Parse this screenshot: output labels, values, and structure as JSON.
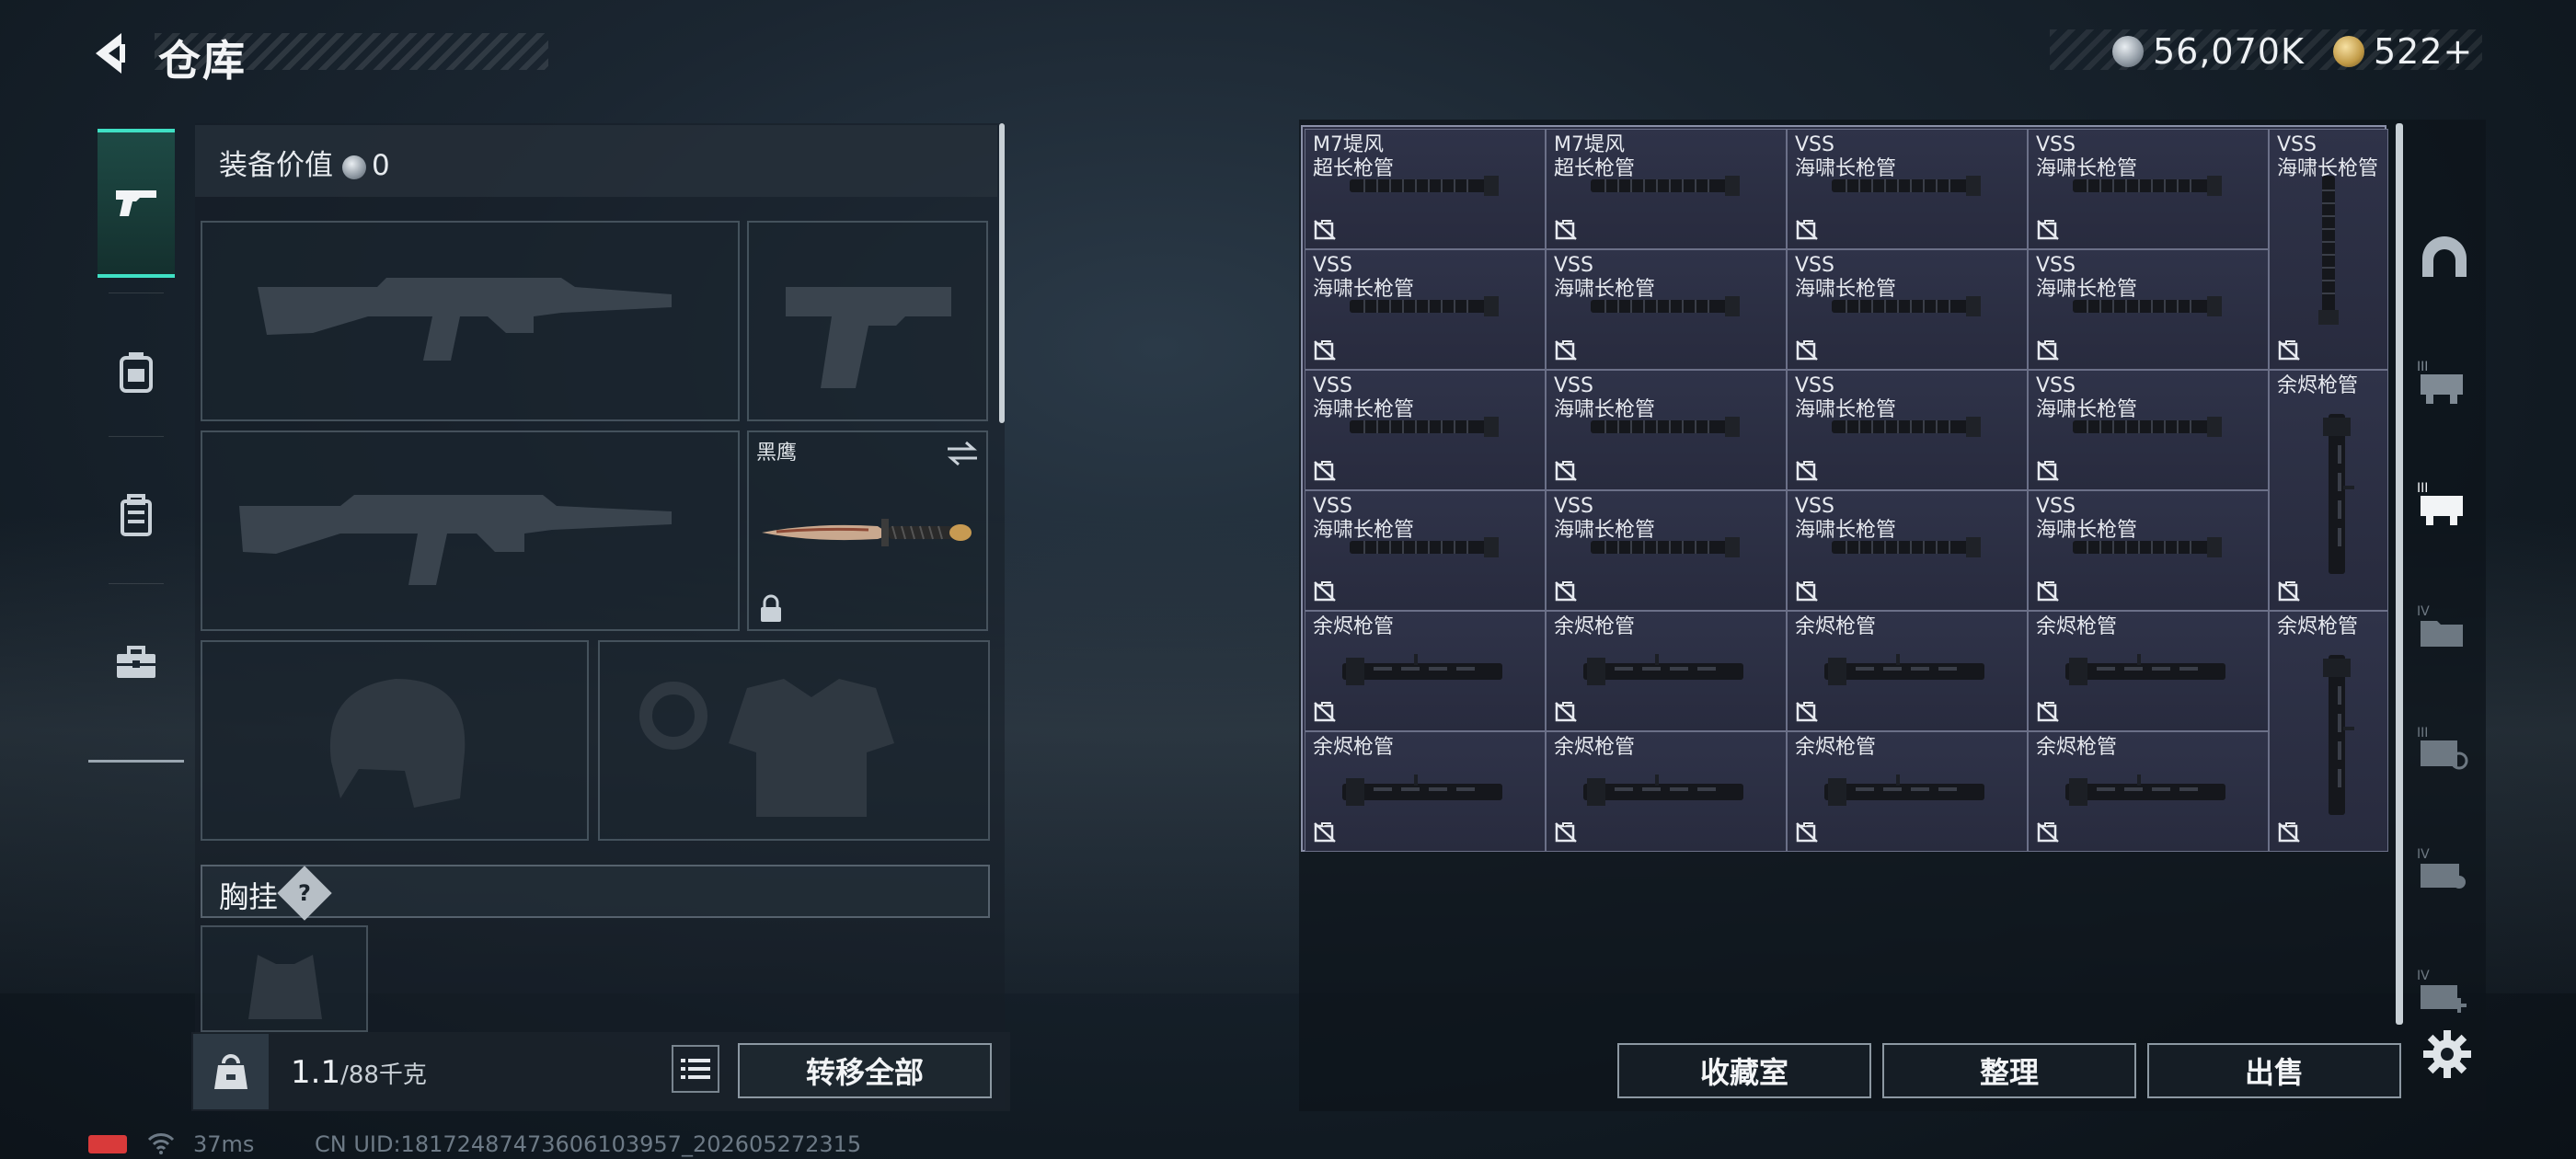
{
  "header": {
    "title": "仓库",
    "currencies": [
      {
        "icon": "silver-coin-icon",
        "value": "56,070K"
      },
      {
        "icon": "gold-coin-icon",
        "value": "522+"
      }
    ]
  },
  "left_rail": {
    "tabs": [
      {
        "icon": "pistol-icon",
        "active": true
      },
      {
        "icon": "backpack-armor-icon",
        "active": false
      },
      {
        "icon": "backpack-icon",
        "active": false
      },
      {
        "icon": "toolbox-icon",
        "active": false
      }
    ]
  },
  "equipment": {
    "value_label": "装备价值",
    "value": "0",
    "melee_label": "黑鹰",
    "chest_label": "胸挂",
    "help": "?"
  },
  "bottom_left": {
    "weight_current": "1.1",
    "weight_capacity": "/88千克",
    "transfer_all": "转移全部"
  },
  "storage": {
    "rows": [
      [
        "M7堤风\n超长枪管",
        "M7堤风\n超长枪管",
        "VSS\n海啸长枪管",
        "VSS\n海啸长枪管"
      ],
      [
        "VSS\n海啸长枪管",
        "VSS\n海啸长枪管",
        "VSS\n海啸长枪管",
        "VSS\n海啸长枪管"
      ],
      [
        "VSS\n海啸长枪管",
        "VSS\n海啸长枪管",
        "VSS\n海啸长枪管",
        "VSS\n海啸长枪管"
      ],
      [
        "VSS\n海啸长枪管",
        "VSS\n海啸长枪管",
        "VSS\n海啸长枪管",
        "VSS\n海啸长枪管"
      ],
      [
        "余烬枪管",
        "余烬枪管",
        "余烬枪管",
        "余烬枪管"
      ],
      [
        "余烬枪管",
        "余烬枪管",
        "余烬枪管",
        "余烬枪管"
      ]
    ],
    "tall_column": [
      "VSS\n海啸长枪管",
      "余烬枪管",
      "余烬枪管"
    ]
  },
  "right_rail": {
    "tabs": [
      "helmet-icon",
      "ammo-rack-iii-icon",
      "ammo-rack-iii-active-icon",
      "folder-iv-icon",
      "refresh-iii-icon",
      "case-iv-icon",
      "add-iv-icon"
    ]
  },
  "bottom_right": {
    "buttons": [
      "收藏室",
      "整理",
      "出售"
    ]
  },
  "status": {
    "ping": "37ms",
    "uid": "CN UID:181724874736061​03957_202605272315"
  }
}
